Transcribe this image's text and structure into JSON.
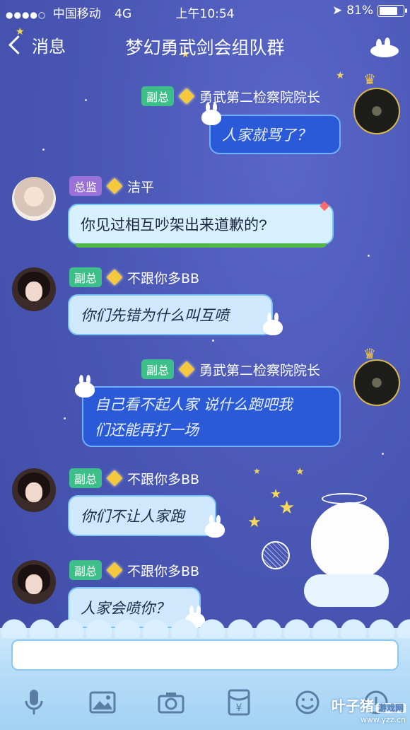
{
  "status_bar": {
    "signal": "●●●●○",
    "carrier": "中国移动",
    "network": "4G",
    "time": "上午10:54",
    "battery": "81%",
    "battery_level": 0.81
  },
  "nav": {
    "back_label": "消息",
    "title": "梦幻勇武剑会组队群"
  },
  "messages": [
    {
      "direction": "out",
      "role": "副总",
      "name": "勇武第二检察院院长",
      "text": "人家就骂了？"
    },
    {
      "direction": "in",
      "role": "总监",
      "name": "洁平",
      "text": "你见过相互吵架出来道歉的?"
    },
    {
      "direction": "in",
      "role": "副总",
      "name": "不跟你多BB",
      "text": "你们先错为什么叫互喷"
    },
    {
      "direction": "out",
      "role": "副总",
      "name": "勇武第二检察院院长",
      "text_line1": "自己看不起人家 说什么跑吧我",
      "text_line2": "们还能再打一场"
    },
    {
      "direction": "in",
      "role": "副总",
      "name": "不跟你多BB",
      "text": "你们不让人家跑"
    },
    {
      "direction": "in",
      "role": "副总",
      "name": "不跟你多BB",
      "text": "人家会喷你？"
    }
  ],
  "toolbar": {
    "icons": [
      "microphone-icon",
      "image-icon",
      "camera-icon",
      "red-packet-icon",
      "emoji-icon",
      "more-icon"
    ]
  },
  "watermark": {
    "name": "叶子猪",
    "tag": "游戏网",
    "url": "www.yzz.cn"
  },
  "colors": {
    "background": "#4a58b7",
    "badge_green": "#3dbf8a",
    "badge_purple": "#9a71d8",
    "bubble_out": "#2a5ad8",
    "bubble_in": "#cfe8fb"
  }
}
